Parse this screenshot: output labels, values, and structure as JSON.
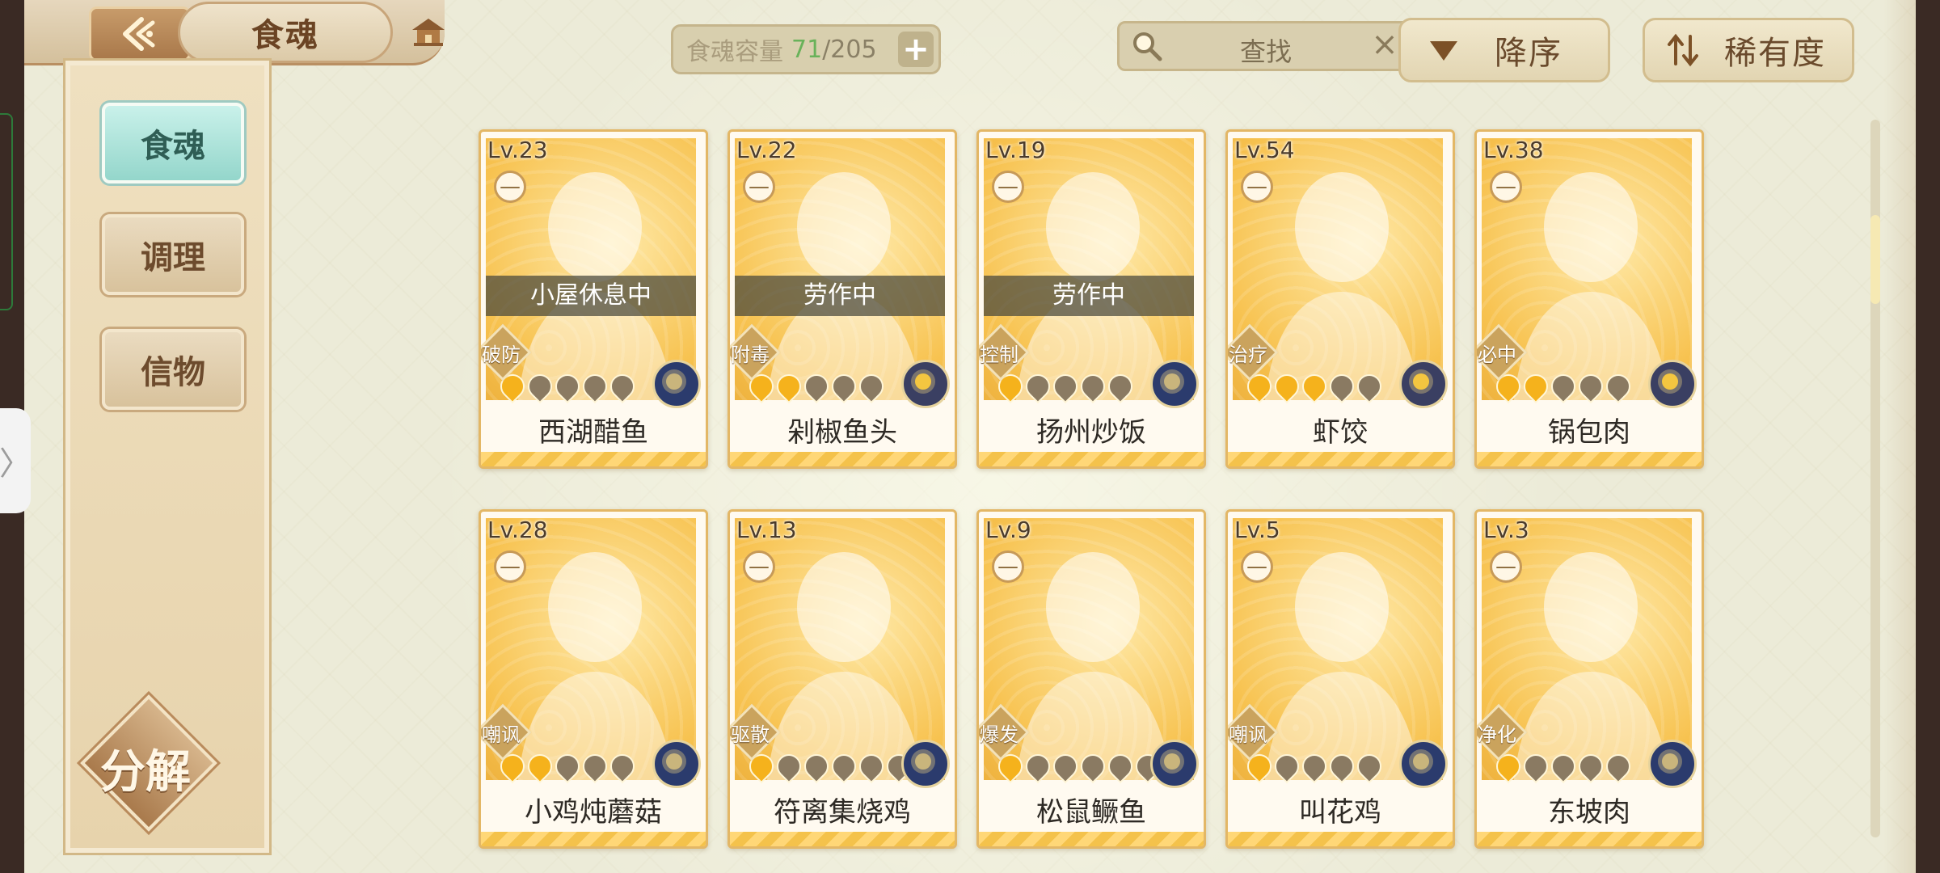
{
  "header": {
    "title": "食魂",
    "capacity_label": "食魂容量",
    "capacity_current": "71",
    "capacity_sep": "/",
    "capacity_max": "205",
    "capacity_add": "+",
    "search_placeholder": "查找",
    "search_clear": "×",
    "sort_order_label": "降序",
    "sort_key_label": "稀有度"
  },
  "sidebar": {
    "tabs": [
      {
        "label": "食魂",
        "active": true
      },
      {
        "label": "调理",
        "active": false
      },
      {
        "label": "信物",
        "active": false
      }
    ],
    "decompose_label": "分解"
  },
  "side_handle_glyph": "〉",
  "minus_glyph": "—",
  "cards": [
    {
      "level": "Lv.23",
      "name": "西湖醋鱼",
      "status": "小屋休息中",
      "role": "破防",
      "stars": 5,
      "stars_on": 1,
      "emblem": "blue"
    },
    {
      "level": "Lv.22",
      "name": "剁椒鱼头",
      "status": "劳作中",
      "role": "附毒",
      "stars": 5,
      "stars_on": 2,
      "emblem": "gold"
    },
    {
      "level": "Lv.19",
      "name": "扬州炒饭",
      "status": "劳作中",
      "role": "控制",
      "stars": 5,
      "stars_on": 1,
      "emblem": "blue"
    },
    {
      "level": "Lv.54",
      "name": "虾饺",
      "status": "",
      "role": "治疗",
      "stars": 5,
      "stars_on": 3,
      "emblem": "gold"
    },
    {
      "level": "Lv.38",
      "name": "锅包肉",
      "status": "",
      "role": "必中",
      "stars": 5,
      "stars_on": 2,
      "emblem": "gold"
    },
    {
      "level": "Lv.28",
      "name": "小鸡炖蘑菇",
      "status": "",
      "role": "嘲讽",
      "stars": 5,
      "stars_on": 2,
      "emblem": "blue"
    },
    {
      "level": "Lv.13",
      "name": "符离集烧鸡",
      "status": "",
      "role": "驱散",
      "stars": 6,
      "stars_on": 1,
      "emblem": "blue"
    },
    {
      "level": "Lv.9",
      "name": "松鼠鳜鱼",
      "status": "",
      "role": "爆发",
      "stars": 6,
      "stars_on": 1,
      "emblem": "blue"
    },
    {
      "level": "Lv.5",
      "name": "叫花鸡",
      "status": "",
      "role": "嘲讽",
      "stars": 5,
      "stars_on": 1,
      "emblem": "blue"
    },
    {
      "level": "Lv.3",
      "name": "东坡肉",
      "status": "",
      "role": "净化",
      "stars": 5,
      "stars_on": 1,
      "emblem": "blue"
    }
  ]
}
